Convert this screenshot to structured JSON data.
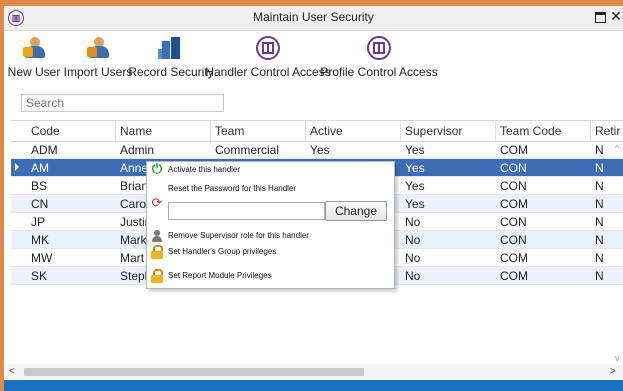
{
  "window": {
    "title": "Maintain User Security"
  },
  "toolbar": {
    "new_user": "New User",
    "import_users": "Import Users",
    "record_security": "Record Security",
    "handler_control_access": "Handler Control Access",
    "profile_control_access": "Profile Control Access"
  },
  "search": {
    "placeholder": "Search"
  },
  "grid": {
    "columns": [
      "Code",
      "Name",
      "Team",
      "Active",
      "Supervisor",
      "Team Code",
      "Retir"
    ],
    "rows": [
      {
        "code": "ADM",
        "name": "Admin",
        "team": "Commercial",
        "active": "Yes",
        "supervisor": "Yes",
        "team_code": "COM",
        "retired": "N"
      },
      {
        "code": "AM",
        "name": "Anne",
        "team": "",
        "active": "",
        "supervisor": "Yes",
        "team_code": "CON",
        "retired": "N"
      },
      {
        "code": "BS",
        "name": "Brian",
        "team": "",
        "active": "",
        "supervisor": "Yes",
        "team_code": "CON",
        "retired": "N"
      },
      {
        "code": "CN",
        "name": "Caro",
        "team": "",
        "active": "",
        "supervisor": "Yes",
        "team_code": "COM",
        "retired": "N"
      },
      {
        "code": "JP",
        "name": "Justin",
        "team": "",
        "active": "",
        "supervisor": "No",
        "team_code": "CON",
        "retired": "N"
      },
      {
        "code": "MK",
        "name": "Mark",
        "team": "",
        "active": "",
        "supervisor": "No",
        "team_code": "CON",
        "retired": "N"
      },
      {
        "code": "MW",
        "name": "Mart",
        "team": "",
        "active": "",
        "supervisor": "No",
        "team_code": "COM",
        "retired": "N"
      },
      {
        "code": "SK",
        "name": "Steph",
        "team": "",
        "active": "",
        "supervisor": "No",
        "team_code": "COM",
        "retired": "N"
      }
    ]
  },
  "context_menu": {
    "activate": "Activate this handler",
    "reset_password": "Reset the Password for this Handler",
    "change_button": "Change",
    "remove_supervisor": "Remove Supervisor role for this handler",
    "group_privileges": "Set Handler's Group privileges",
    "report_privileges": "Set Report Module Privileges"
  }
}
